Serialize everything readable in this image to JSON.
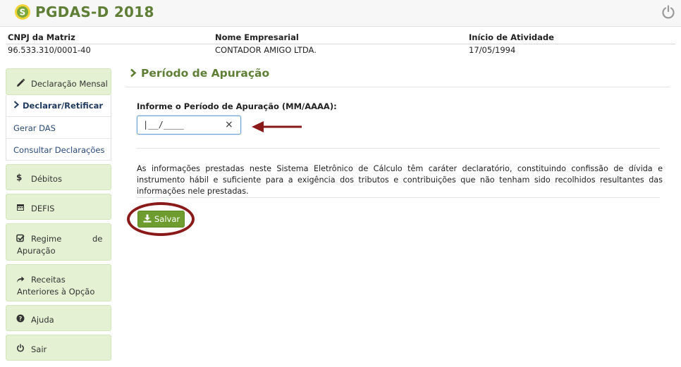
{
  "app": {
    "title": "PGDAS-D 2018"
  },
  "company": {
    "cnpj_label": "CNPJ da Matriz",
    "cnpj_value": "96.533.310/0001-40",
    "name_label": "Nome Empresarial",
    "name_value": "CONTADOR AMIGO LTDA.",
    "start_label": "Início de Atividade",
    "start_value": "17/05/1994"
  },
  "sidebar": {
    "declaracao": "Declaração Mensal",
    "declarar": "Declarar/Retificar",
    "gerar_das": "Gerar DAS",
    "consultar": "Consultar Declarações",
    "debitos": "Débitos",
    "defis": "DEFIS",
    "regime_1": "Regime",
    "regime_2": "de",
    "regime_3": "Apuração",
    "receitas_1": "Receitas",
    "receitas_2": "Anteriores à Opção",
    "ajuda": "Ajuda",
    "sair": "Sair"
  },
  "main": {
    "page_title": "Período de Apuração",
    "field_label": "Informe o Período de Apuração (MM/AAAA):",
    "input_value": "|__/____",
    "clear_symbol": "×",
    "paragraph": "As informações prestadas neste Sistema Eletrônico de Cálculo têm caráter declaratório, constituindo confissão de dívida e instrumento hábil e suficiente para a exigência dos tributos e contribuições que não tenham sido recolhidos resultantes das informações nele prestadas.",
    "save_label": "Salvar"
  },
  "colors": {
    "brand_green": "#5f7f36",
    "menu_bg": "#e4f2d3",
    "save_bg": "#6e9c2f",
    "annotation_red": "#8a1a1a"
  },
  "icons": [
    "logo-icon",
    "power-icon",
    "pencil-icon",
    "chevron-right-icon",
    "dollar-icon",
    "calendar-icon",
    "check-square-icon",
    "share-arrow-icon",
    "question-icon",
    "download-icon"
  ]
}
